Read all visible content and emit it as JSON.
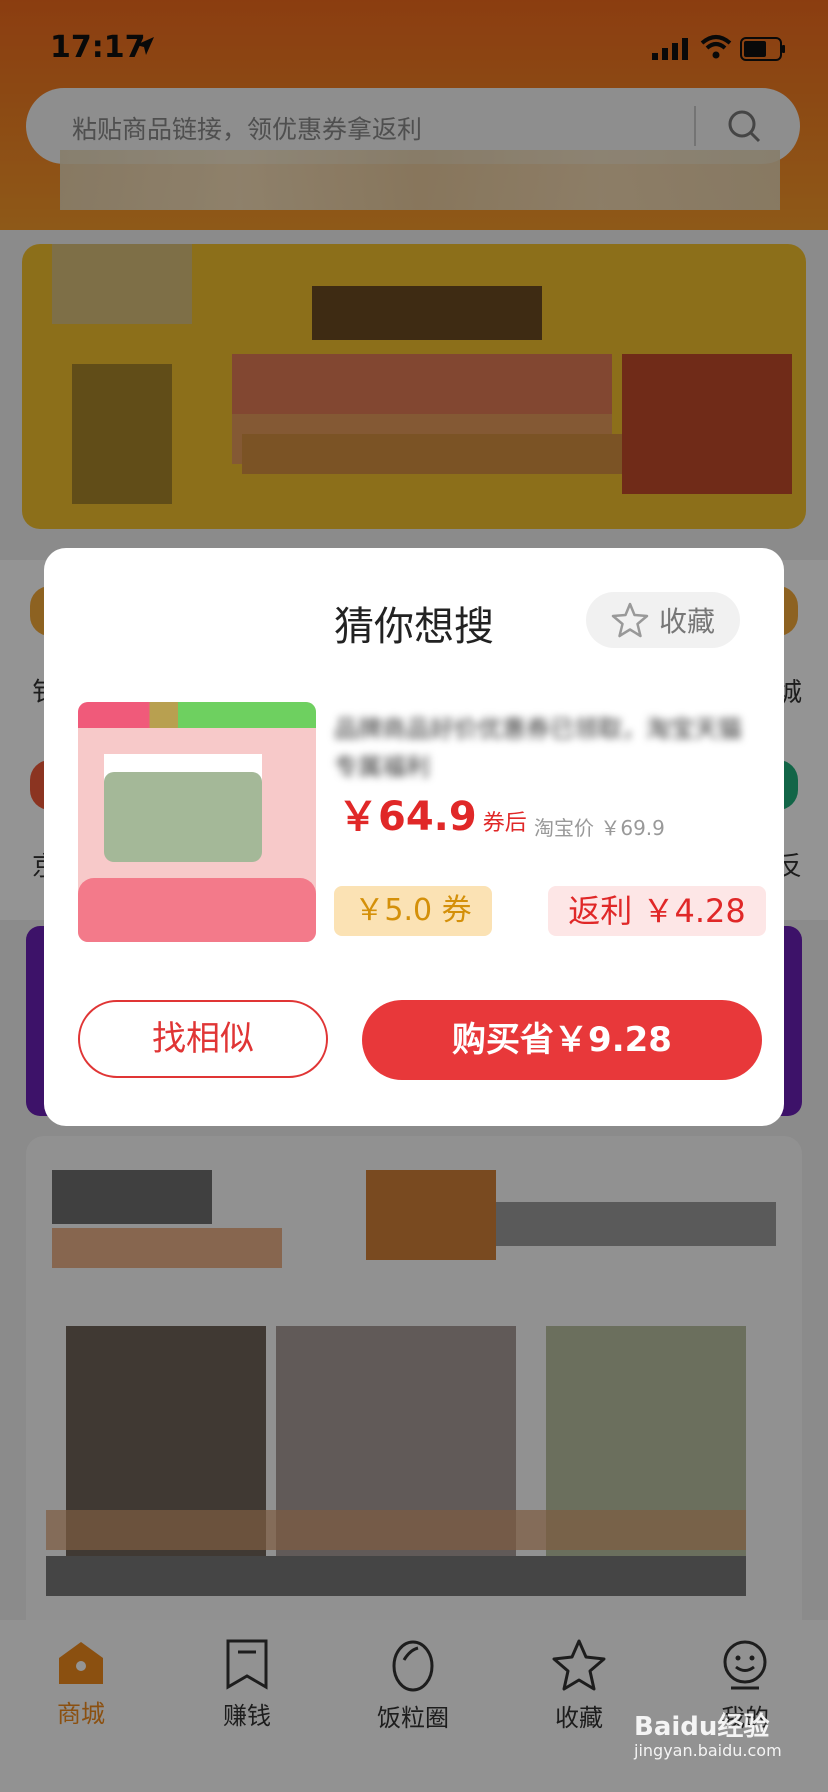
{
  "status_bar": {
    "time": "17:17"
  },
  "search": {
    "placeholder": "粘贴商品链接，领优惠券拿返利"
  },
  "side_chars": {
    "left_1": "钅",
    "left_2": "京",
    "right_1": "城",
    "right_2": "反"
  },
  "dialog": {
    "title": "猜你想搜",
    "favorite_label": "收藏",
    "product": {
      "title": "品牌商品好价优惠券已领取，淘宝天猫专属福利",
      "price": "￥64.9",
      "price_note": "券后",
      "taobao_price_label": "淘宝价",
      "taobao_price": "￥69.9",
      "coupon": "￥5.0 券",
      "rebate": "返利 ￥4.28"
    },
    "find_similar_label": "找相似",
    "buy_label": "购买省￥9.28"
  },
  "tab_bar": {
    "items": [
      {
        "label": "商城",
        "icon": "home-icon",
        "active": true
      },
      {
        "label": "赚钱",
        "icon": "bookmark-icon",
        "active": false
      },
      {
        "label": "饭粒圈",
        "icon": "rice-grain-icon",
        "active": false
      },
      {
        "label": "收藏",
        "icon": "star-icon",
        "active": false
      },
      {
        "label": "我的",
        "icon": "profile-icon",
        "active": false
      }
    ]
  },
  "watermark": {
    "brand": "Baidu经验",
    "url": "jingyan.baidu.com"
  },
  "colors": {
    "accent_red": "#e8383a",
    "active_tab": "#f08a1d",
    "header_orange": "#f06a1d"
  }
}
